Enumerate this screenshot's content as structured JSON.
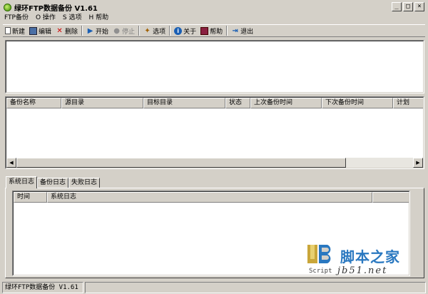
{
  "window": {
    "title": "绿环FTP数据备份 V1.61"
  },
  "menu": [
    "FTP备份",
    "O 操作",
    "S 选项",
    "H 帮助"
  ],
  "toolbar": {
    "new": "新建",
    "edit": "编辑",
    "delete": "删除",
    "start": "开始",
    "stop": "停止",
    "options": "选项",
    "about": "关于",
    "help": "帮助",
    "exit": "退出"
  },
  "task_list": {
    "columns": [
      "备份名称",
      "源目录",
      "目标目录",
      "状态",
      "上次备份时间",
      "下次备份时间",
      "计划"
    ]
  },
  "tabs": [
    "系统日志",
    "备份日志",
    "失败日志"
  ],
  "log": {
    "columns": [
      "时间",
      "系统日志"
    ]
  },
  "watermark": {
    "cn": "脚本之家",
    "script": "Script",
    "url": "jb51.net"
  },
  "status": {
    "text": "绿环FTP数据备份 V1.61"
  },
  "colors": {
    "face": "#d4d0c8",
    "accent": "#2a78c0"
  }
}
